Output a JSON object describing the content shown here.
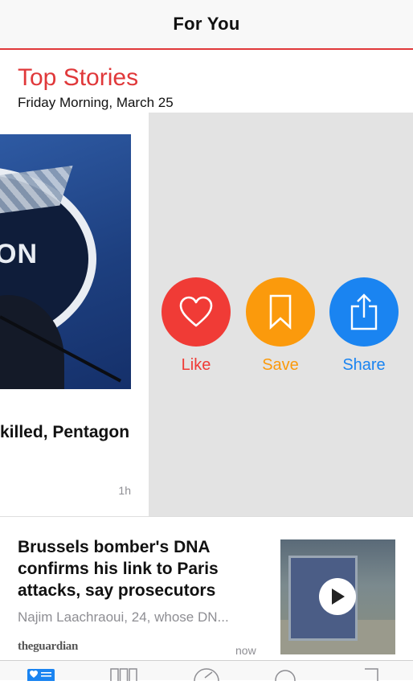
{
  "nav": {
    "title": "For You"
  },
  "section": {
    "title": "Top Stories",
    "date": "Friday Morning, March 25"
  },
  "story1": {
    "headline_visible": "killed, Pentagon",
    "image_text": "ON",
    "time": "1h"
  },
  "actions": [
    {
      "label": "Like",
      "icon": "heart-icon",
      "color": "#f03b36"
    },
    {
      "label": "Save",
      "icon": "bookmark-icon",
      "color": "#fb9a0c"
    },
    {
      "label": "Share",
      "icon": "share-icon",
      "color": "#1a84f1"
    }
  ],
  "story2": {
    "headline": "Brussels bomber's DNA confirms his link to Paris attacks, say prosecutors",
    "excerpt": "Najim Laachraoui, 24, whose DN...",
    "source": "theguardian",
    "time": "now",
    "thumb_icon": "play-icon"
  },
  "tabbar": {
    "tabs": [
      {
        "icon": "for-you-icon",
        "active": true
      },
      {
        "icon": "favorites-icon",
        "active": false
      },
      {
        "icon": "explore-icon",
        "active": false
      },
      {
        "icon": "search-icon",
        "active": false
      },
      {
        "icon": "saved-icon",
        "active": false
      }
    ],
    "accent": "#1a84f1"
  },
  "colors": {
    "brand_red": "#e0383a"
  }
}
